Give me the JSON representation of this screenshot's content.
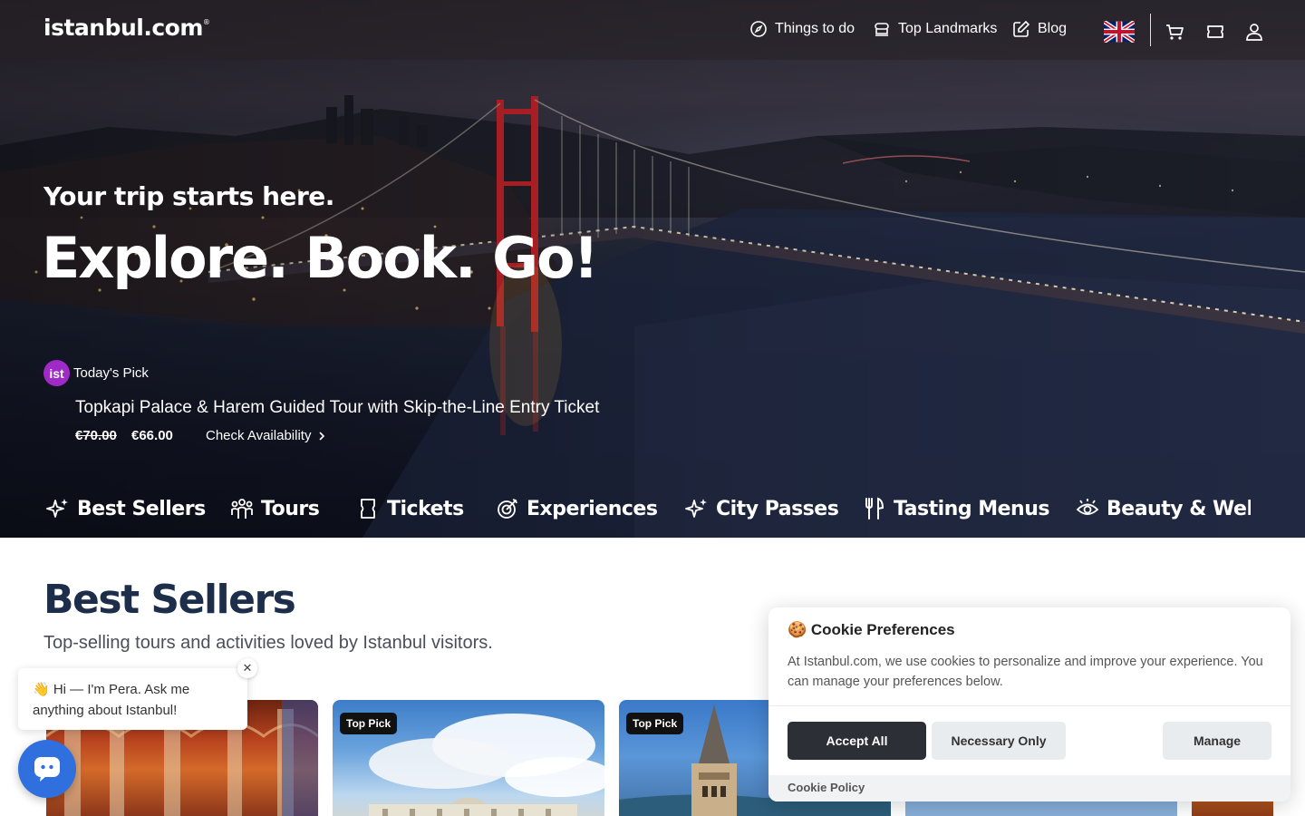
{
  "header": {
    "logo": "istanbul.com",
    "logo_mark": "®",
    "nav": [
      {
        "label": "Things to do",
        "icon": "compass-icon"
      },
      {
        "label": "Top Landmarks",
        "icon": "landmark-icon"
      },
      {
        "label": "Blog",
        "icon": "edit-icon"
      }
    ],
    "language_icon": "uk-flag-icon",
    "icons": [
      "cart-icon",
      "ticket-icon",
      "user-icon"
    ]
  },
  "hero": {
    "tagline": "Your trip starts here.",
    "headline": "Explore. Book. Go!",
    "todays_pick": {
      "badge": "ist",
      "label": "Today's Pick",
      "title": "Topkapi Palace & Harem Guided Tour with Skip-the-Line Entry Ticket",
      "old_price": "€70.00",
      "new_price": "€66.00",
      "cta": "Check Availability"
    }
  },
  "categories": [
    {
      "label": "Best Sellers",
      "icon": "sparkles-icon"
    },
    {
      "label": "Tours",
      "icon": "group-icon"
    },
    {
      "label": "Tickets",
      "icon": "ticket-icon"
    },
    {
      "label": "Experiences",
      "icon": "target-icon"
    },
    {
      "label": "City Passes",
      "icon": "sparkles-icon"
    },
    {
      "label": "Tasting Menus",
      "icon": "utensils-icon"
    },
    {
      "label": "Beauty & Wellness",
      "icon": "eye-icon"
    }
  ],
  "best_sellers": {
    "title": "Best Sellers",
    "subtitle": "Top-selling tours and activities loved by Istanbul visitors.",
    "cards": [
      {
        "tag": ""
      },
      {
        "tag": "Top Pick"
      },
      {
        "tag": "Top Pick"
      },
      {
        "tag": ""
      },
      {
        "tag": ""
      }
    ]
  },
  "chat": {
    "message": "👋 Hi — I'm Pera. Ask me anything about Istanbul!",
    "close": "✕"
  },
  "cookie": {
    "title": "🍪 Cookie Preferences",
    "text": "At Istanbul.com, we use cookies to personalize and improve your experience. You can manage your preferences below.",
    "accept": "Accept All",
    "necessary": "Necessary Only",
    "manage": "Manage",
    "policy": "Cookie Policy"
  }
}
